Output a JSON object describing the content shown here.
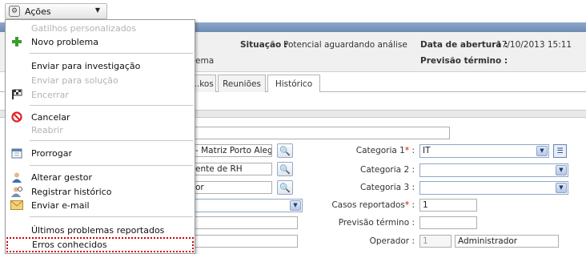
{
  "actions_button": {
    "label": "Ações"
  },
  "menu": {
    "items": [
      {
        "label": "Gatilhos personalizados",
        "disabled": true
      },
      {
        "label": "Novo problema",
        "disabled": false,
        "icon": "plus-icon"
      },
      {
        "label": "Enviar para investigação",
        "disabled": false
      },
      {
        "label": "Enviar para solução",
        "disabled": true
      },
      {
        "label": "Encerrar",
        "disabled": true,
        "icon": "finish-flag-icon"
      },
      {
        "label": "Cancelar",
        "disabled": false,
        "icon": "cancel-icon"
      },
      {
        "label": "Reabrir",
        "disabled": true
      },
      {
        "label": "Prorrogar",
        "disabled": false,
        "icon": "calendar-icon"
      },
      {
        "label": "Alterar gestor",
        "disabled": false,
        "icon": "user-icon"
      },
      {
        "label": "Registrar histórico",
        "disabled": false,
        "icon": "user-history-icon"
      },
      {
        "label": "Enviar e-mail",
        "disabled": false,
        "icon": "envelope-icon"
      },
      {
        "label": "Últimos problemas reportados",
        "disabled": false
      },
      {
        "label": "Erros conhecidos",
        "disabled": false,
        "highlighted": true
      }
    ]
  },
  "info": {
    "situacao_label": "Situação :",
    "situacao_value": "Potencial aguardando análise",
    "abertura_label": "Data de abertura :",
    "abertura_value": "17/10/2013 15:11",
    "previsao_label": "Previsão término :",
    "left_partial": "ema"
  },
  "tabs": [
    "...kos",
    "Reuniões",
    "Histórico"
  ],
  "form": {
    "field_empresa": "- Matriz Porto Aleg",
    "field_solicitante": "ente de RH",
    "field_or": "or",
    "categoria1_label": "Categoria 1",
    "categoria1_value": "IT",
    "categoria2_label": "Categoria 2 :",
    "categoria3_label": "Categoria 3 :",
    "casos_label": "Casos reportados",
    "casos_value": "1",
    "previsao_label": "Previsão término :",
    "operador_label": "Operador :",
    "operador_id": "1",
    "operador_name": "Administrador"
  },
  "colors": {
    "accent_band": "#6d8ab3",
    "highlight_outline": "#d40000"
  }
}
